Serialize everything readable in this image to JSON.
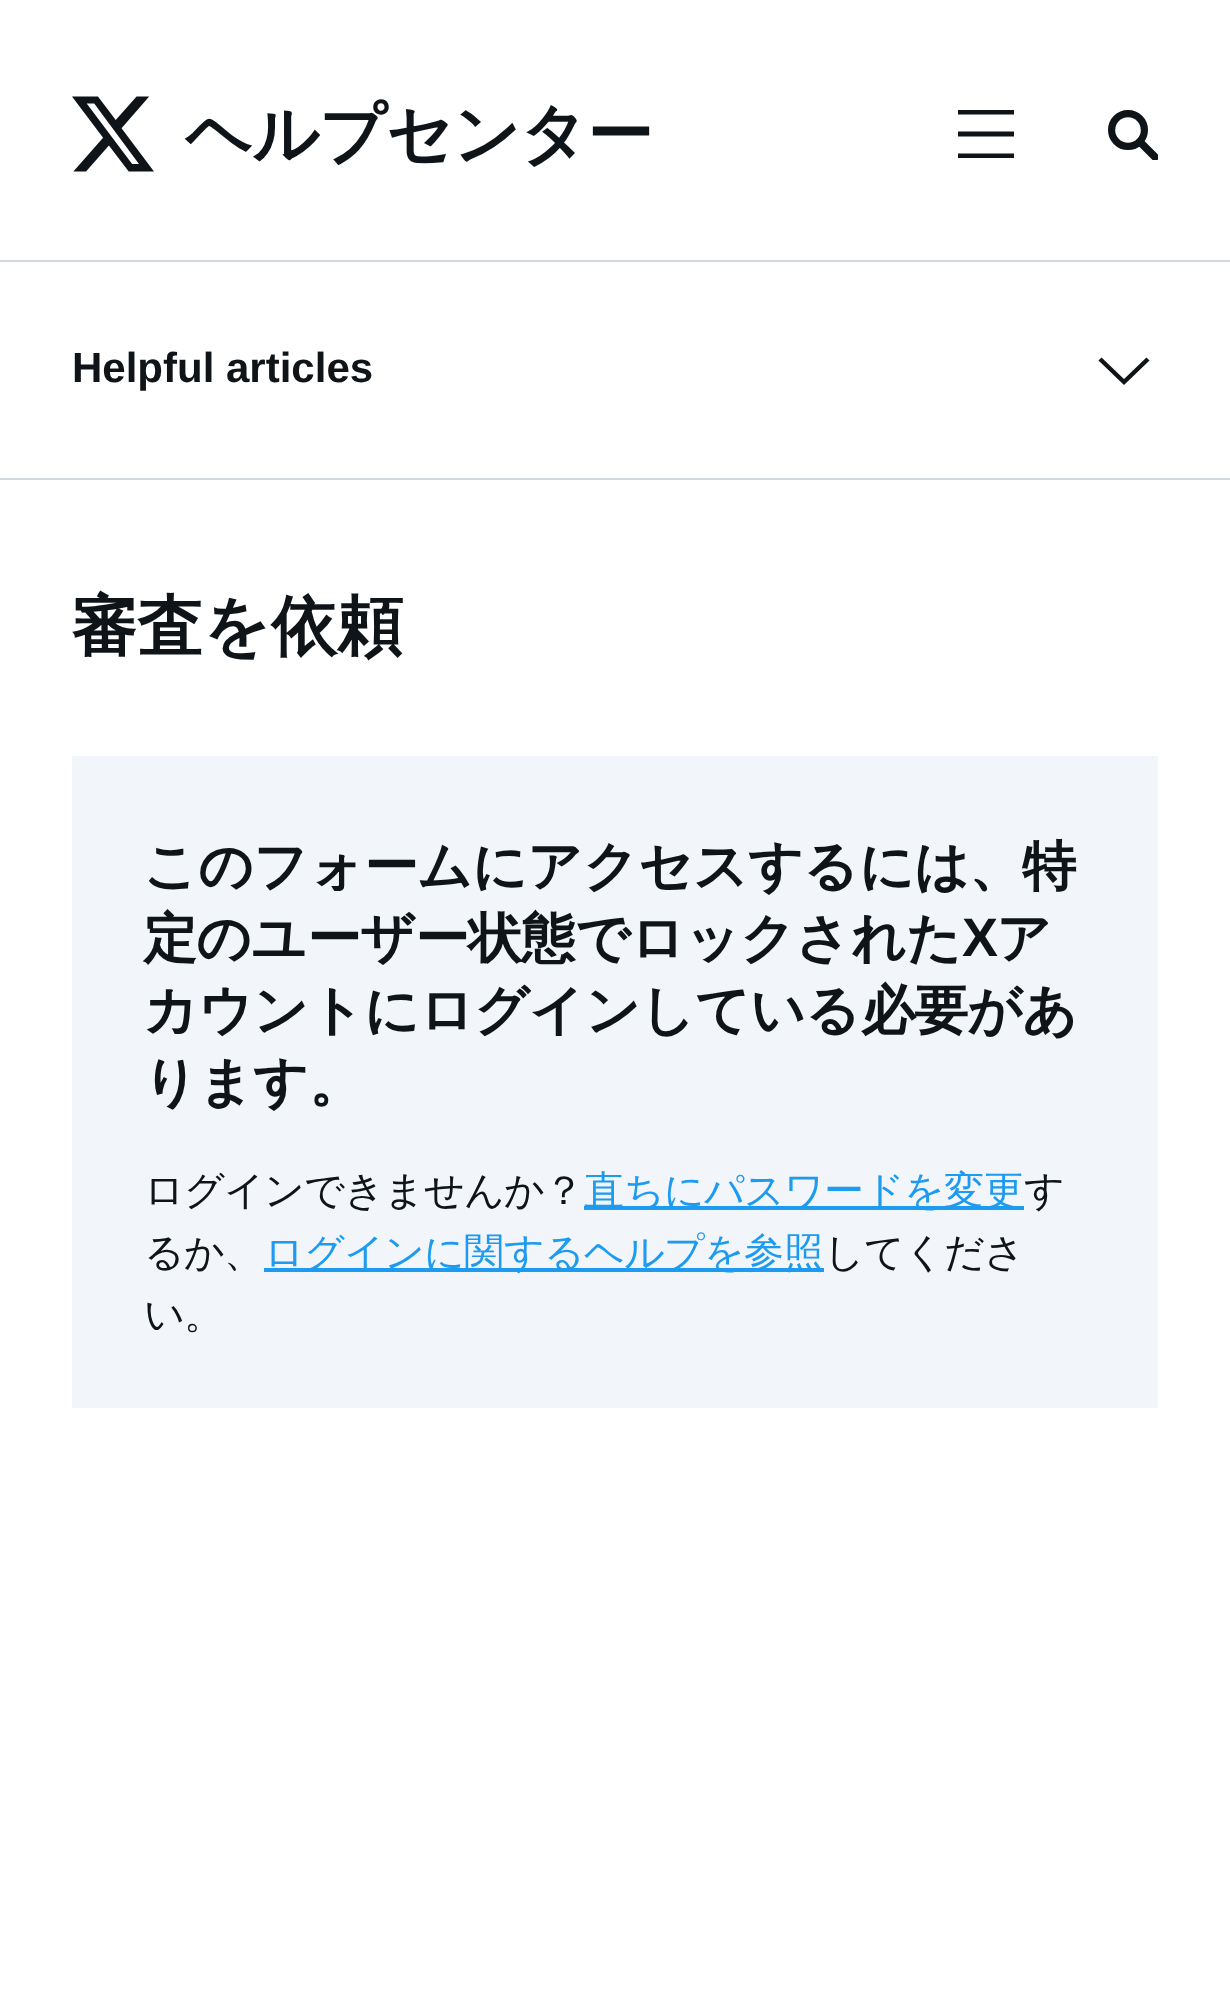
{
  "header": {
    "title": "ヘルプセンター"
  },
  "accordion": {
    "label": "Helpful articles",
    "expanded": false
  },
  "page_title": "審査を依頼",
  "notice": {
    "heading": "このフォームにアクセスするには、特定のユーザー状態でロックされたXアカウントにログインしている必要があります。",
    "body": [
      {
        "kind": "text",
        "text": "ログインできませんか？"
      },
      {
        "kind": "link",
        "text": "直ちにパスワードを変更"
      },
      {
        "kind": "text",
        "text": "するか、"
      },
      {
        "kind": "link",
        "text": "ログインに関するヘルプを参照"
      },
      {
        "kind": "text",
        "text": "してください。"
      }
    ]
  }
}
